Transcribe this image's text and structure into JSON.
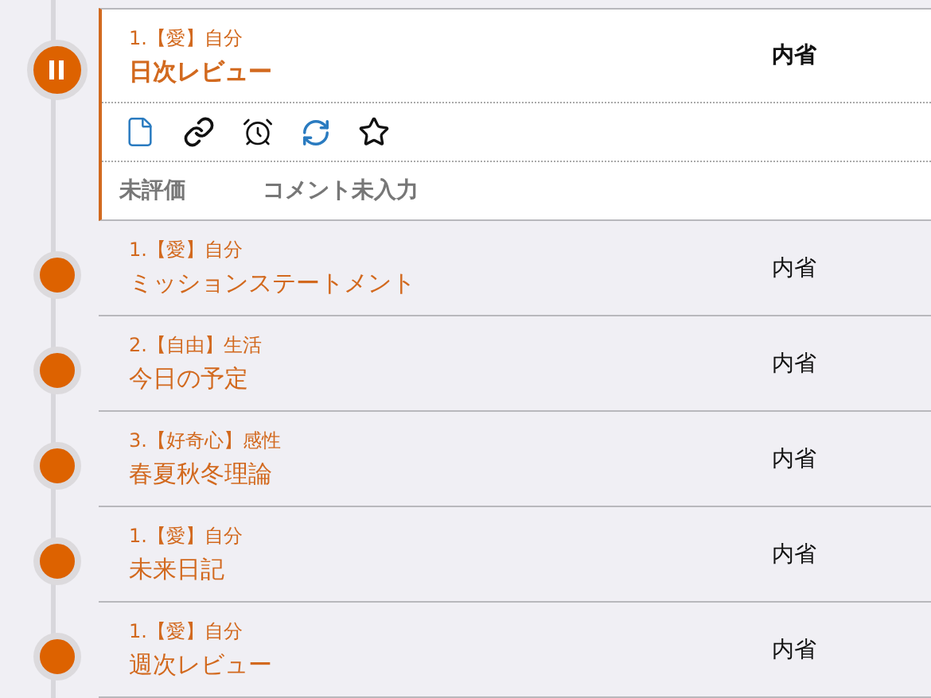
{
  "items": [
    {
      "category": "1.【愛】自分",
      "title": "日次レビュー",
      "type": "内省",
      "selected": true,
      "evaluation": "未評価",
      "comment": "コメント未入力"
    },
    {
      "category": "1.【愛】自分",
      "title": "ミッションステートメント",
      "type": "内省",
      "selected": false
    },
    {
      "category": "2.【自由】生活",
      "title": "今日の予定",
      "type": "内省",
      "selected": false
    },
    {
      "category": "3.【好奇心】感性",
      "title": "春夏秋冬理論",
      "type": "内省",
      "selected": false
    },
    {
      "category": "1.【愛】自分",
      "title": "未来日記",
      "type": "内省",
      "selected": false
    },
    {
      "category": "1.【愛】自分",
      "title": "週次レビュー",
      "type": "内省",
      "selected": false
    }
  ]
}
